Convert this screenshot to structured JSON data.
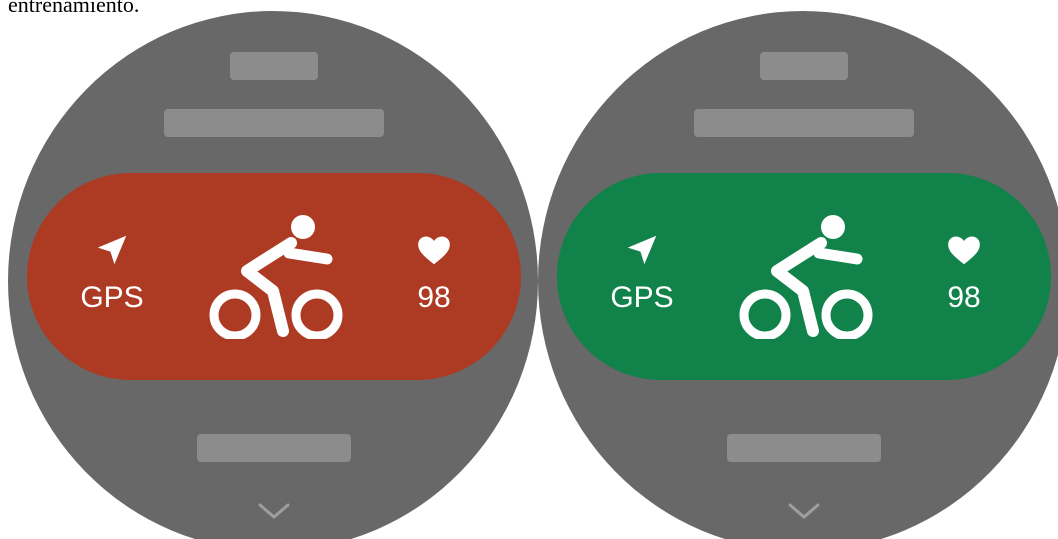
{
  "caption": "entrenamiento.",
  "screens": [
    {
      "state": "error",
      "pill_color": "#ad3a23",
      "gps_label": "GPS",
      "heart_rate": "98",
      "icons": [
        "navigation-arrow-icon",
        "cycling-icon",
        "heart-icon",
        "chevron-down-icon"
      ]
    },
    {
      "state": "ready",
      "pill_color": "#11824a",
      "gps_label": "GPS",
      "heart_rate": "98",
      "icons": [
        "navigation-arrow-icon",
        "cycling-icon",
        "heart-icon",
        "chevron-down-icon"
      ]
    }
  ]
}
